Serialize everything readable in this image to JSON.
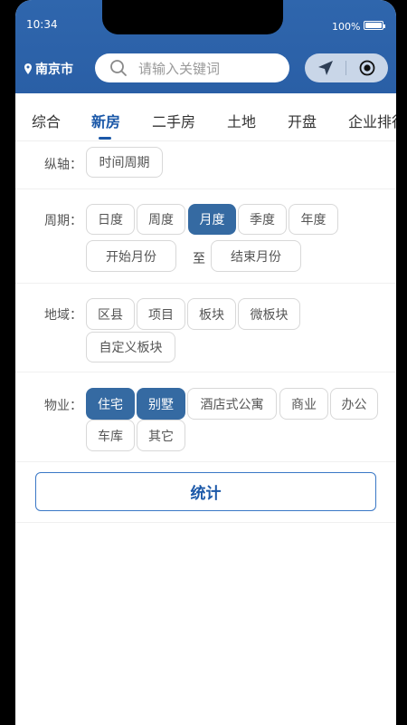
{
  "status": {
    "time": "10:34",
    "battery": "100%"
  },
  "header": {
    "city": "南京市",
    "search_placeholder": "请输入关键词"
  },
  "tabs": [
    {
      "label": "综合"
    },
    {
      "label": "新房",
      "active": true
    },
    {
      "label": "二手房"
    },
    {
      "label": "土地"
    },
    {
      "label": "开盘"
    },
    {
      "label": "企业排行"
    }
  ],
  "filters": {
    "axis": {
      "label": "纵轴：",
      "options": [
        "时间周期"
      ]
    },
    "period": {
      "label": "周期：",
      "options": [
        "日度",
        "周度",
        "月度",
        "季度",
        "年度"
      ],
      "selected": "月度",
      "start": "开始月份",
      "to": "至",
      "end": "结束月份"
    },
    "region": {
      "label": "地域：",
      "options": [
        "区县",
        "项目",
        "板块",
        "微板块",
        "自定义板块"
      ]
    },
    "property": {
      "label": "物业：",
      "options": [
        "住宅",
        "别墅",
        "酒店式公寓",
        "商业",
        "办公",
        "车库",
        "其它"
      ],
      "selected": [
        "住宅",
        "别墅"
      ]
    }
  },
  "action": {
    "submit_label": "统计"
  },
  "colors": {
    "header": "#2f66ad",
    "accent": "#1b58a8",
    "chip_selected": "#356aa2"
  }
}
